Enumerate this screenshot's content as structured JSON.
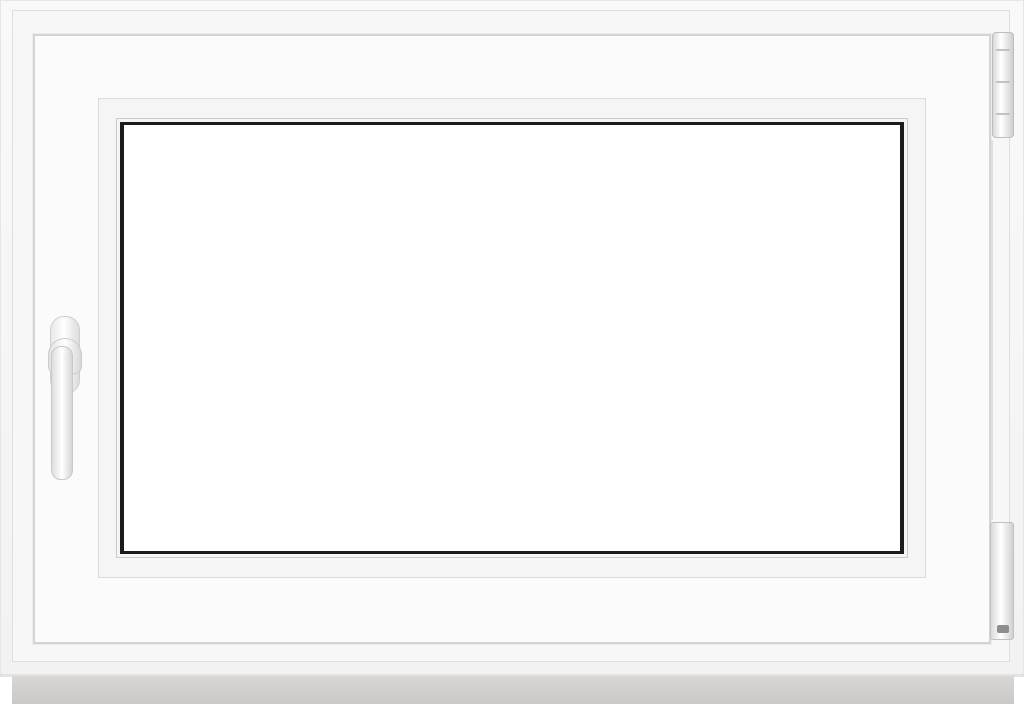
{
  "image": {
    "subject": "casement-window",
    "colors": {
      "frame": "#f7f7f7",
      "sash": "#fbfbfb",
      "glass": "#ffffff",
      "gasket": "#1b1b1b",
      "handle": "#f0f0f0",
      "hinge": "#e0e0e0",
      "sill": "#cfcccb"
    },
    "icons": {
      "handle": "window-handle-icon",
      "top_hinge": "hinge-icon",
      "bottom_hinge": "hinge-icon"
    }
  }
}
